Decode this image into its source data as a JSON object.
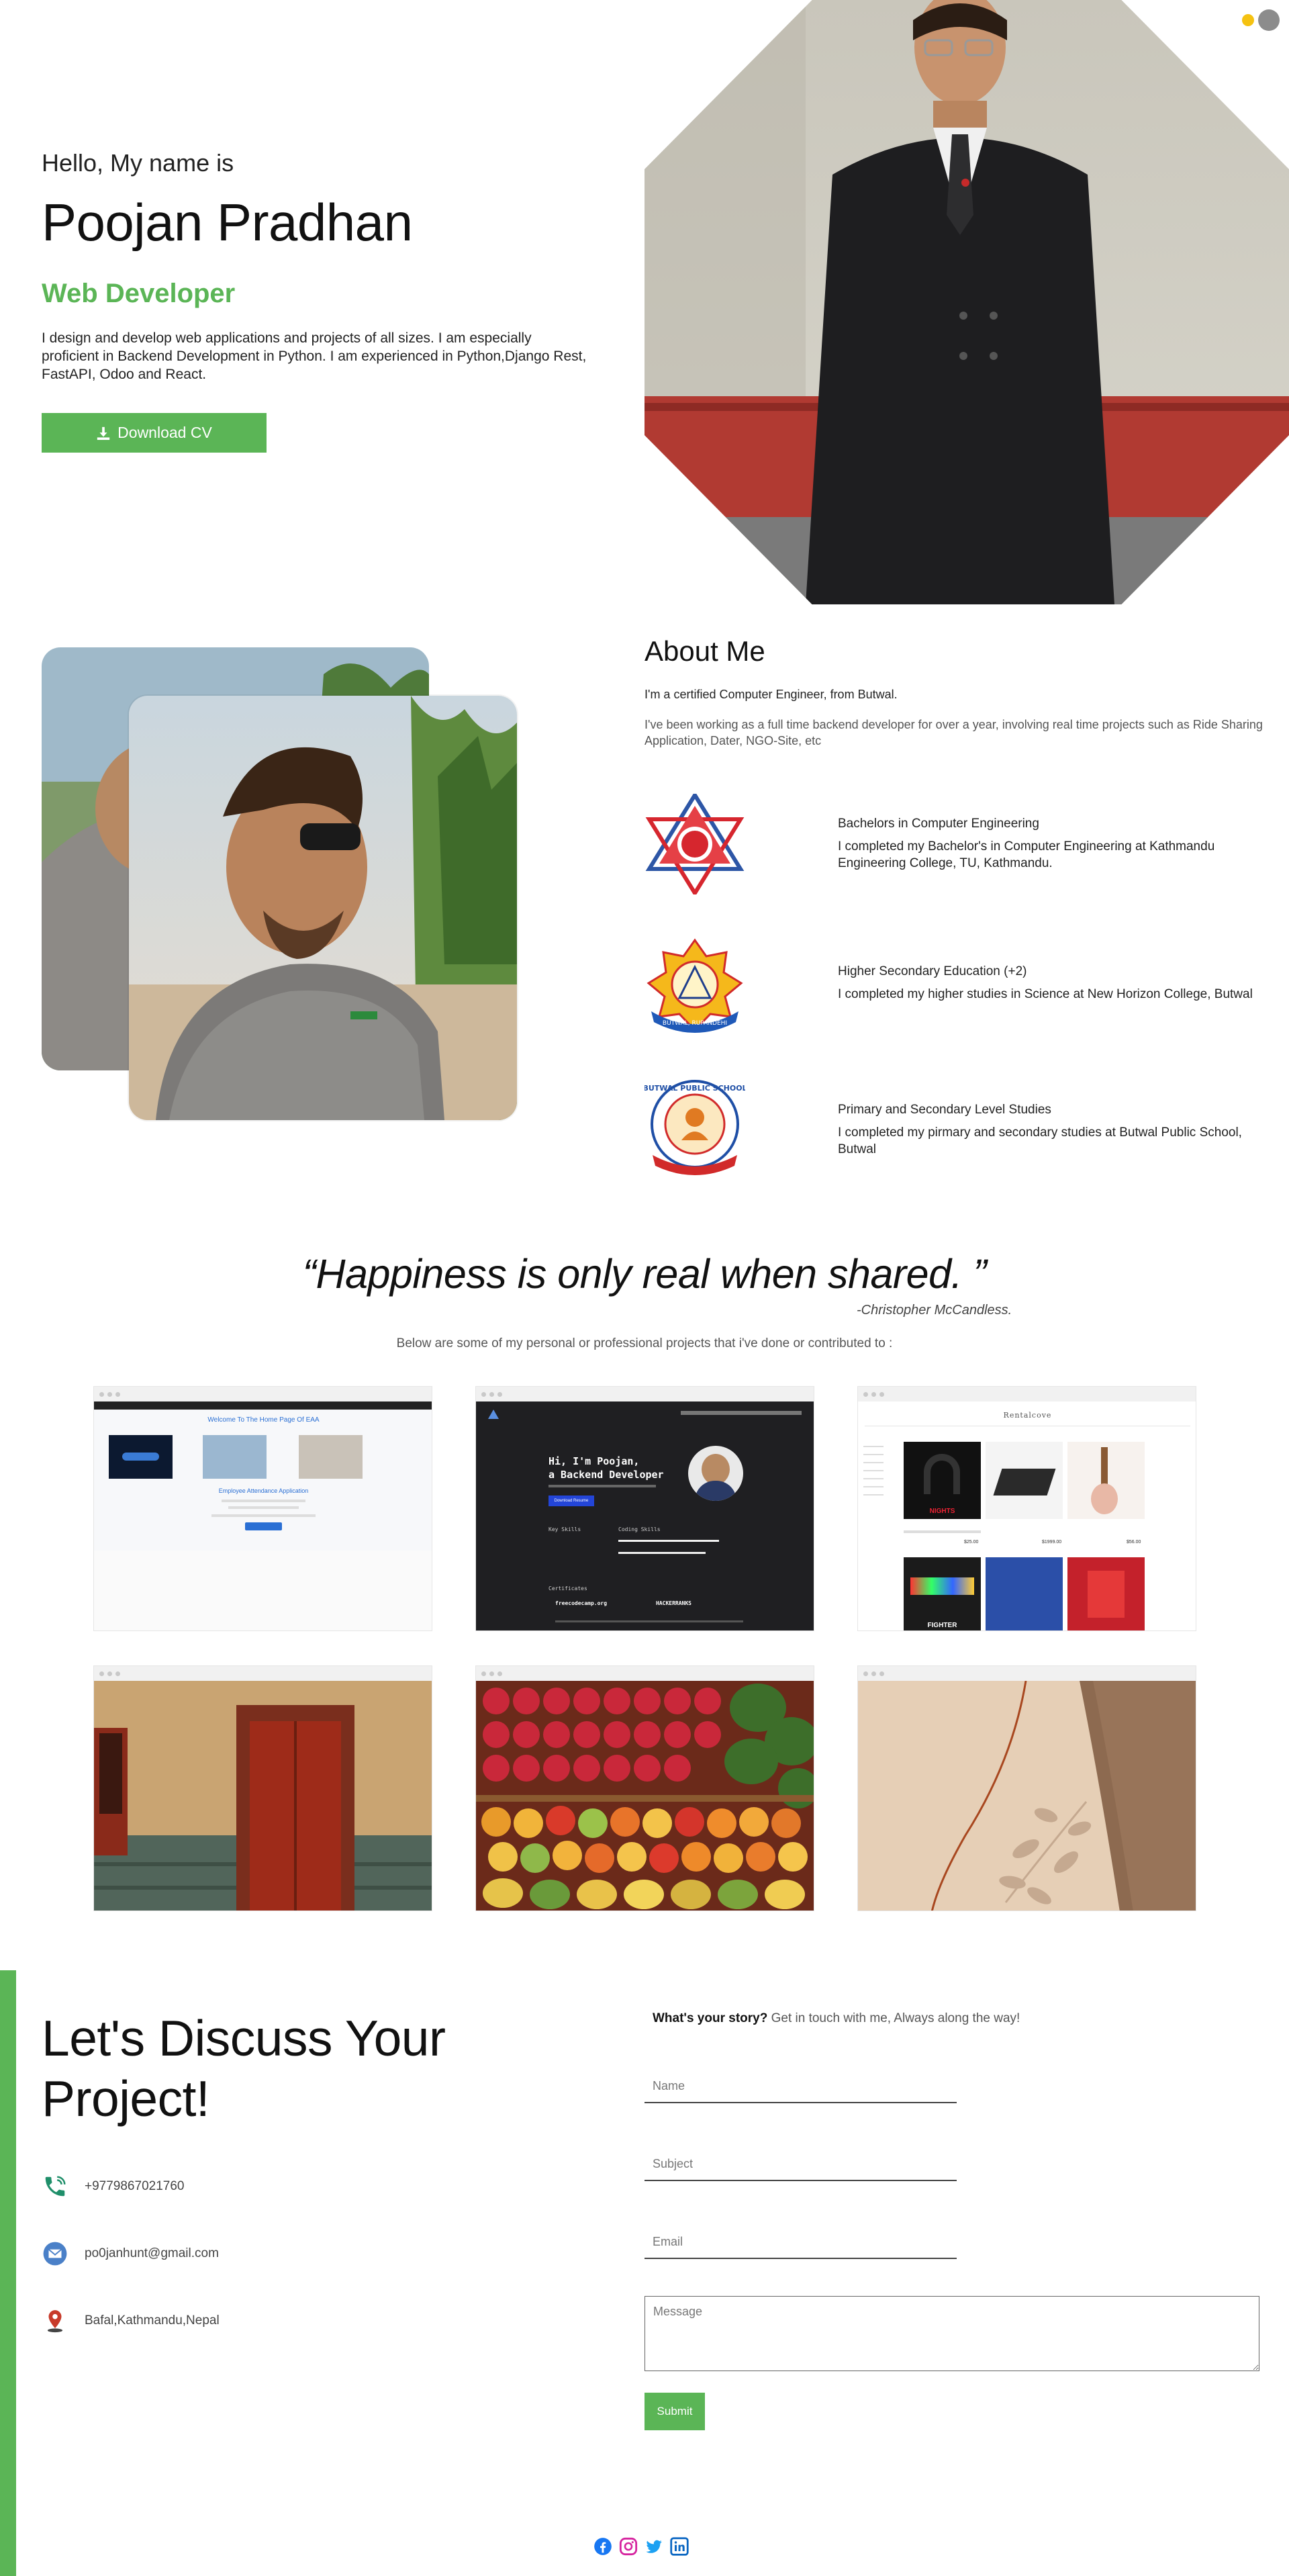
{
  "theme": {
    "accent": "#5bb556",
    "toggle_light": "#f5c211",
    "toggle_dark": "#8c8c8c"
  },
  "hero": {
    "greeting": "Hello, My name is",
    "name": "Poojan Pradhan",
    "role": "Web Developer",
    "bio": "I design and develop web applications and projects of all sizes. I am especially proficient in Backend Development in Python. I am experienced in Python,Django Rest, FastAPI, Odoo and React.",
    "download_label": "Download CV",
    "download_icon": "download-icon"
  },
  "about": {
    "title": "About Me",
    "p1": "I'm a certified Computer Engineer, from Butwal.",
    "p2": "I've been working as a full time backend developer for over a year, involving real time projects such as Ride Sharing Application, Dater, NGO-Site, etc"
  },
  "education": [
    {
      "title": "Bachelors in Computer Engineering",
      "desc": "I completed my Bachelor's in Computer Engineering at Kathmandu Engineering College, TU, Kathmandu."
    },
    {
      "title": "Higher Secondary Education (+2)",
      "desc": "I completed my higher studies in Science at New Horizon College, Butwal",
      "logo_text": "BUTWAL, RUPANDEHI"
    },
    {
      "title": "Primary and Secondary Level Studies",
      "desc": "I completed my pirmary and secondary studies at Butwal Public School, Butwal",
      "logo_text": "BUTWAL PUBLIC SCHOOL"
    }
  ],
  "quote": {
    "text": "“Happiness is only real when shared. ”",
    "author": "-Christopher McCandless."
  },
  "projects_intro": "Below are some of my personal or professional projects that i've done or contributed to :",
  "projects": {
    "p1": {
      "heading": "Welcome To The Home Page Of EAA",
      "sub": "Employee Attendance Application"
    },
    "p2": {
      "line1": "Hi, I'm Poojan,",
      "line2": "a Backend Developer",
      "button": "Download Resume",
      "skills_a": "Key Skills",
      "skills_b": "Coding Skills",
      "cert": "Certificates",
      "cert1": "freecodecamp.org",
      "cert2": "HACKERRANKS"
    },
    "p3": {
      "brand": "Rentalcove",
      "tag": "NIGHTS",
      "tag2": "FIGHTER",
      "price1": "$25.00",
      "price2": "$1999.00",
      "price3": "$56.00"
    }
  },
  "contact": {
    "title": "Let's Discuss Your Project!",
    "phone": "+9779867021760",
    "email": "po0janhunt@gmail.com",
    "location": "Bafal,Kathmandu,Nepal",
    "story_bold": "What's your story?",
    "story_rest": " Get in touch with me, Always along the way!",
    "name_ph": "Name",
    "subject_ph": "Subject",
    "email_ph": "Email",
    "message_ph": "Message",
    "submit_label": "Submit"
  },
  "socials": [
    "facebook-icon",
    "instagram-icon",
    "twitter-icon",
    "linkedin-icon"
  ]
}
